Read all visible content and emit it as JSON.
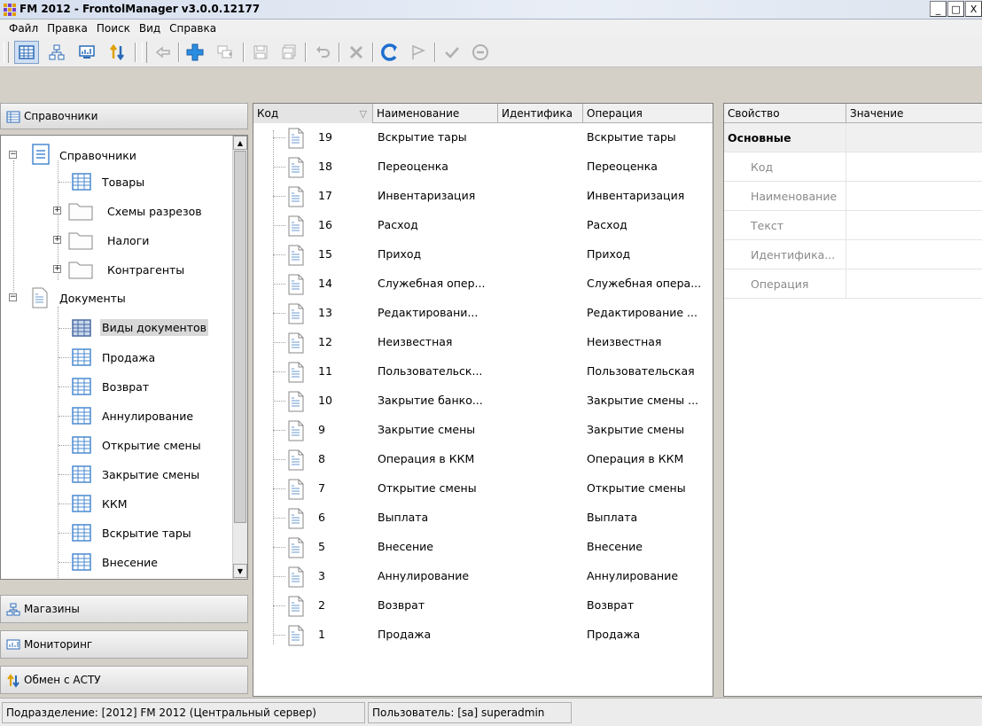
{
  "window": {
    "title": "FM 2012 - FrontolManager v3.0.0.12177",
    "minimize": "_",
    "maximize": "□",
    "close": "X"
  },
  "menu": [
    "Файл",
    "Правка",
    "Поиск",
    "Вид",
    "Справка"
  ],
  "toolbar": {
    "buttons": [
      "grid-view-icon",
      "network-icon",
      "monitor-icon",
      "exchange-arrows-icon",
      "back-arrow-icon",
      "add-plus-icon",
      "copy-add-icon",
      "save-icon",
      "save-all-icon",
      "undo-icon",
      "delete-icon",
      "refresh-icon",
      "flag-icon",
      "check-icon",
      "cancel-circle-icon"
    ]
  },
  "left_panel": {
    "header": "Справочники",
    "tree": [
      {
        "label": "Справочники",
        "level": 0,
        "icon": "catalog-icon",
        "expander": "minus"
      },
      {
        "label": "Товары",
        "level": 1,
        "icon": "table-icon"
      },
      {
        "label": "Схемы разрезов",
        "level": 1,
        "icon": "folder-icon",
        "expander": "plus"
      },
      {
        "label": "Налоги",
        "level": 1,
        "icon": "folder-icon",
        "expander": "plus"
      },
      {
        "label": "Контрагенты",
        "level": 1,
        "icon": "folder-icon",
        "expander": "plus"
      },
      {
        "label": "Документы",
        "level": 0,
        "icon": "document-icon",
        "expander": "minus"
      },
      {
        "label": "Виды документов",
        "level": 1,
        "icon": "table-icon",
        "selected": true
      },
      {
        "label": "Продажа",
        "level": 1,
        "icon": "table-icon"
      },
      {
        "label": "Возврат",
        "level": 1,
        "icon": "table-icon"
      },
      {
        "label": "Аннулирование",
        "level": 1,
        "icon": "table-icon"
      },
      {
        "label": "Открытие смены",
        "level": 1,
        "icon": "table-icon"
      },
      {
        "label": "Закрытие смены",
        "level": 1,
        "icon": "table-icon"
      },
      {
        "label": "ККМ",
        "level": 1,
        "icon": "table-icon"
      },
      {
        "label": "Вскрытие тары",
        "level": 1,
        "icon": "table-icon"
      },
      {
        "label": "Внесение",
        "level": 1,
        "icon": "table-icon"
      }
    ],
    "bottom_buttons": [
      {
        "label": "Магазины",
        "icon": "stores-icon"
      },
      {
        "label": "Мониторинг",
        "icon": "monitoring-icon"
      },
      {
        "label": "Обмен с АСТУ",
        "icon": "exchange-icon"
      }
    ]
  },
  "grid": {
    "columns": [
      "Код",
      "Наименование",
      "Идентифика",
      "Операция"
    ],
    "rows": [
      {
        "code": "19",
        "name": "Вскрытие тары",
        "op": "Вскрытие тары"
      },
      {
        "code": "18",
        "name": "Переоценка",
        "op": "Переоценка"
      },
      {
        "code": "17",
        "name": "Инвентаризация",
        "op": "Инвентаризация"
      },
      {
        "code": "16",
        "name": "Расход",
        "op": "Расход"
      },
      {
        "code": "15",
        "name": "Приход",
        "op": "Приход"
      },
      {
        "code": "14",
        "name": "Служебная опер...",
        "op": "Служебная опера..."
      },
      {
        "code": "13",
        "name": "Редактировани...",
        "op": "Редактирование ..."
      },
      {
        "code": "12",
        "name": "Неизвестная",
        "op": "Неизвестная"
      },
      {
        "code": "11",
        "name": "Пользовательск...",
        "op": "Пользовательская"
      },
      {
        "code": "10",
        "name": "Закрытие банко...",
        "op": "Закрытие смены ..."
      },
      {
        "code": "9",
        "name": "Закрытие смены",
        "op": "Закрытие смены"
      },
      {
        "code": "8",
        "name": "Операция в ККМ",
        "op": "Операция в ККМ"
      },
      {
        "code": "7",
        "name": "Открытие смены",
        "op": "Открытие смены"
      },
      {
        "code": "6",
        "name": "Выплата",
        "op": "Выплата"
      },
      {
        "code": "5",
        "name": "Внесение",
        "op": "Внесение"
      },
      {
        "code": "3",
        "name": "Аннулирование",
        "op": "Аннулирование"
      },
      {
        "code": "2",
        "name": "Возврат",
        "op": "Возврат"
      },
      {
        "code": "1",
        "name": "Продажа",
        "op": "Продажа"
      }
    ]
  },
  "properties": {
    "columns": [
      "Свойство",
      "Значение"
    ],
    "category": "Основные",
    "items": [
      "Код",
      "Наименование",
      "Текст",
      "Идентифика...",
      "Операция"
    ]
  },
  "status": {
    "department": "Подразделение: [2012] FM 2012 (Центральный сервер)",
    "user": "Пользователь: [sa] superadmin"
  },
  "colors": {
    "accent": "#1e6fd0",
    "toolbar_plus": "#2a8de0",
    "refresh": "#1e6fd0"
  }
}
